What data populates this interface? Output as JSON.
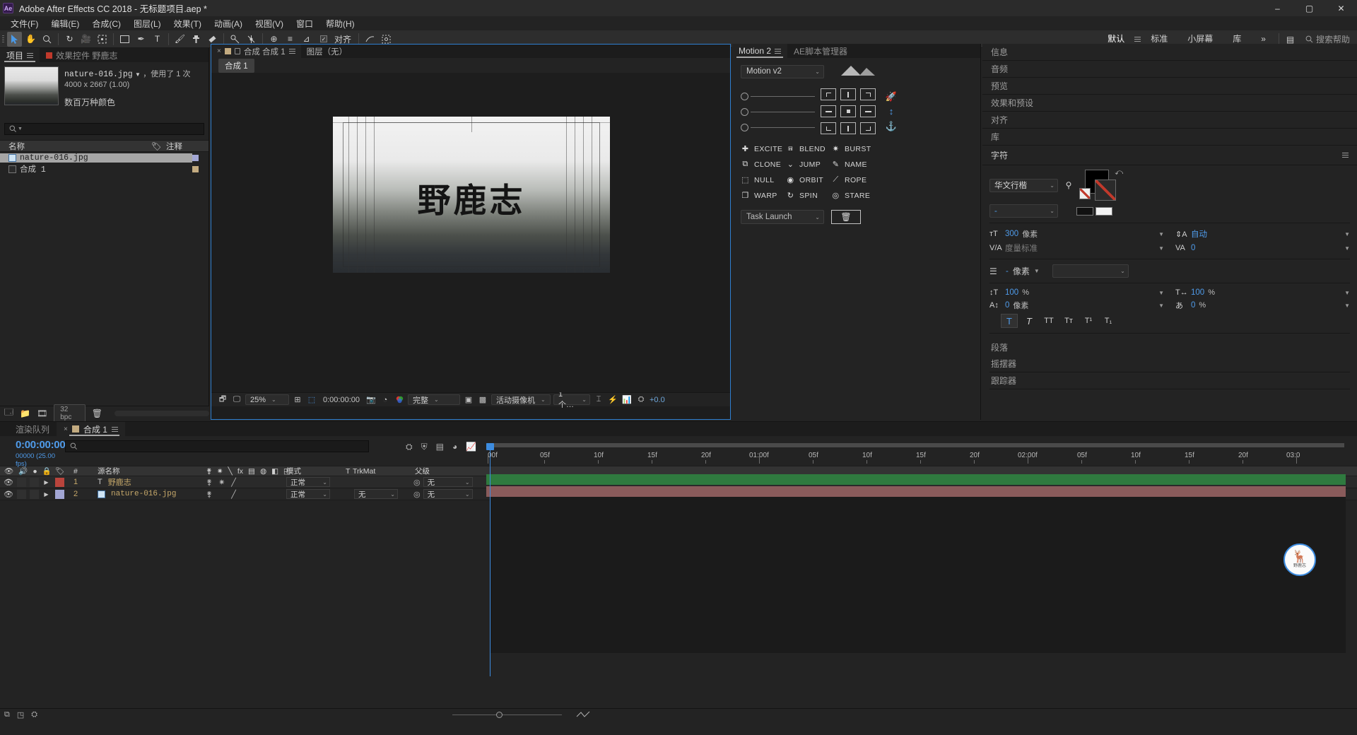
{
  "window": {
    "app_badge": "Ae",
    "title": "Adobe After Effects CC 2018 - 无标题项目.aep *",
    "minimize": "–",
    "maximize": "▢",
    "close": "✕"
  },
  "menubar": {
    "items": [
      "文件(F)",
      "编辑(E)",
      "合成(C)",
      "图层(L)",
      "效果(T)",
      "动画(A)",
      "视图(V)",
      "窗口",
      "帮助(H)"
    ]
  },
  "toolbar": {
    "align_label": "对齐",
    "align_checked": "✓",
    "workspaces": [
      "默认",
      "标准",
      "小屏幕",
      "库"
    ],
    "overflow": "»",
    "search_placeholder": "搜索帮助"
  },
  "project_panel": {
    "tab_project": "项目",
    "tab_effect_controls": "效果控件 野鹿志",
    "file_name": "nature-016.jpg",
    "used_text": "，使用了 1 次",
    "dimensions": "4000 x 2667 (1.00)",
    "color_depth": "数百万种颜色",
    "search_placeholder": "",
    "columns": {
      "name": "名称",
      "label": "",
      "comment": "注释"
    },
    "items": [
      {
        "name": "nature-016.jpg",
        "type": "footage",
        "swatch": "#a2a6d4",
        "selected": true
      },
      {
        "name": "合成 1",
        "type": "composition",
        "swatch": "#c3ab80",
        "selected": false
      }
    ],
    "bit_depth": "32 bpc"
  },
  "composition_viewer": {
    "tab_label": "合成 合成 1",
    "tab_layer": "图层（无）",
    "comp_chip": "合成 1",
    "artboard_title": "野鹿志",
    "zoom": "25%",
    "timecode": "0:00:00:00",
    "quality": "完整",
    "camera": "活动摄像机",
    "views": "1个…",
    "exposure": "+0.0"
  },
  "motion_panel": {
    "tab_motion": "Motion 2",
    "tab_script_manager": "AE脚本管理器",
    "version_select": "Motion v2",
    "actions": [
      {
        "label": "EXCITE",
        "icon": "plus-icon"
      },
      {
        "label": "BLEND",
        "icon": "blend-icon"
      },
      {
        "label": "BURST",
        "icon": "burst-icon"
      },
      {
        "label": "CLONE",
        "icon": "clone-icon"
      },
      {
        "label": "JUMP",
        "icon": "jump-icon"
      },
      {
        "label": "NAME",
        "icon": "pencil-icon"
      },
      {
        "label": "NULL",
        "icon": "null-icon"
      },
      {
        "label": "ORBIT",
        "icon": "orbit-icon"
      },
      {
        "label": "ROPE",
        "icon": "rope-icon"
      },
      {
        "label": "WARP",
        "icon": "warp-icon"
      },
      {
        "label": "SPIN",
        "icon": "spin-icon"
      },
      {
        "label": "STARE",
        "icon": "eye-icon"
      }
    ],
    "task_select": "Task Launch",
    "delete_icon": "trash-icon"
  },
  "right_dock": {
    "panels": [
      "信息",
      "音频",
      "预览",
      "效果和预设",
      "对齐",
      "库"
    ],
    "character": {
      "title": "字符",
      "font_family": "华文行楷",
      "font_style": "-",
      "font_size": {
        "icon": "font-size-icon",
        "value": "300",
        "unit": "像素"
      },
      "leading": {
        "icon": "leading-icon",
        "value": "自动"
      },
      "kerning": {
        "icon": "kerning-icon",
        "value": "度量标准"
      },
      "tracking": {
        "icon": "tracking-icon",
        "value": "0"
      },
      "stroke_width": {
        "icon": "stroke-icon",
        "value": "-",
        "unit": "像素"
      },
      "stroke_style": "",
      "vertical_scale": {
        "icon": "vscale-icon",
        "value": "100",
        "unit": "%"
      },
      "horizontal_scale": {
        "icon": "hscale-icon",
        "value": "100",
        "unit": "%"
      },
      "baseline_shift": {
        "icon": "baseline-icon",
        "value": "0",
        "unit": "像素"
      },
      "tsume": {
        "icon": "tsume-icon",
        "value": "0",
        "unit": "%"
      },
      "styles": [
        "T",
        "T",
        "TT",
        "Tᴛ",
        "T¹",
        "T₁"
      ]
    },
    "paragraph": "段落",
    "wiggler": "摇摆器",
    "tracker": "跟踪器"
  },
  "timeline": {
    "tab_render_queue": "渲染队列",
    "tab_comp": "合成 1",
    "current_time": "0:00:00:00",
    "frame_info": "00000 (25.00 fps)",
    "search_placeholder": "",
    "columns": {
      "num": "#",
      "source_name": "源名称",
      "mode": "模式",
      "trkmat": "TrkMat",
      "parent": "父级"
    },
    "layers": [
      {
        "index": "1",
        "name": "野鹿志",
        "type": "text",
        "color": "#b9443c",
        "mode": "正常",
        "trkmat": "",
        "parent": "无",
        "bar_color": "#2f7a3f"
      },
      {
        "index": "2",
        "name": "nature-016.jpg",
        "type": "footage",
        "color": "#a2a6d4",
        "mode": "正常",
        "trkmat": "无",
        "parent": "无",
        "bar_color": "#8a5b5b"
      }
    ],
    "ruler_labels": [
      "00f",
      "05f",
      "10f",
      "15f",
      "20f",
      "01:00f",
      "05f",
      "10f",
      "15f",
      "20f",
      "02:00f",
      "05f",
      "10f",
      "15f",
      "20f",
      "03:0"
    ]
  },
  "badge": {
    "glyph": "🦌",
    "sub": "野鹿志"
  }
}
